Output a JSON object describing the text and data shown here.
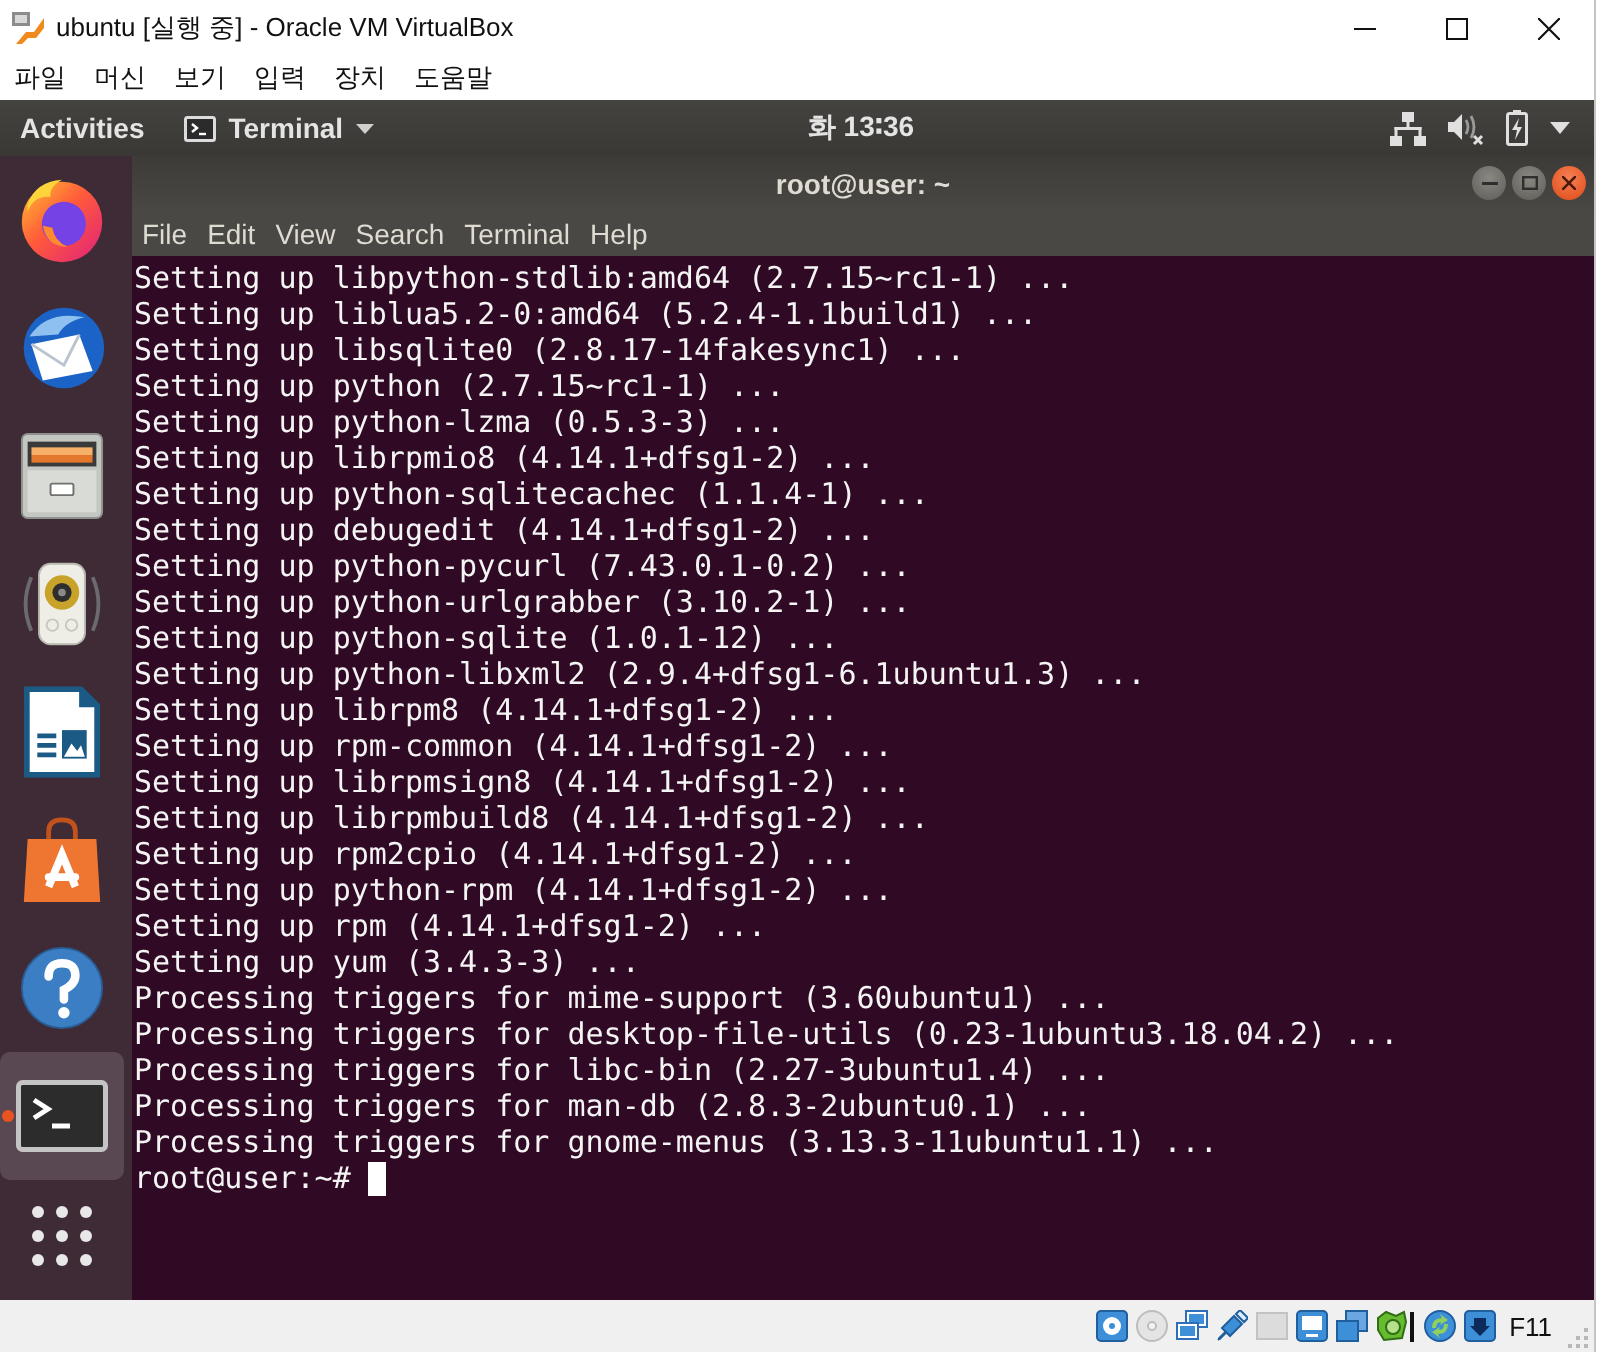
{
  "vbox_window": {
    "title": "ubuntu [실행 중] - Oracle VM VirtualBox"
  },
  "vbox_menu": [
    "파일",
    "머신",
    "보기",
    "입력",
    "장치",
    "도움말"
  ],
  "top_bar": {
    "activities": "Activities",
    "app_menu": "Terminal",
    "clock": "화 13∶36"
  },
  "dock": [
    {
      "kind": "browser",
      "running": false,
      "active": false
    },
    {
      "kind": "mail",
      "running": false,
      "active": false
    },
    {
      "kind": "files",
      "running": false,
      "active": false
    },
    {
      "kind": "music",
      "running": false,
      "active": false
    },
    {
      "kind": "presentation",
      "running": false,
      "active": false
    },
    {
      "kind": "software",
      "running": false,
      "active": false
    },
    {
      "kind": "help",
      "running": false,
      "active": false
    },
    {
      "kind": "terminal",
      "running": true,
      "active": true
    },
    {
      "kind": "apps",
      "running": false,
      "active": false
    }
  ],
  "terminal": {
    "title": "root@user: ~",
    "menu": [
      "File",
      "Edit",
      "View",
      "Search",
      "Terminal",
      "Help"
    ],
    "lines": [
      "Setting up libpython-stdlib:amd64 (2.7.15~rc1-1) ...",
      "Setting up liblua5.2-0:amd64 (5.2.4-1.1build1) ...",
      "Setting up libsqlite0 (2.8.17-14fakesync1) ...",
      "Setting up python (2.7.15~rc1-1) ...",
      "Setting up python-lzma (0.5.3-3) ...",
      "Setting up librpmio8 (4.14.1+dfsg1-2) ...",
      "Setting up python-sqlitecachec (1.1.4-1) ...",
      "Setting up debugedit (4.14.1+dfsg1-2) ...",
      "Setting up python-pycurl (7.43.0.1-0.2) ...",
      "Setting up python-urlgrabber (3.10.2-1) ...",
      "Setting up python-sqlite (1.0.1-12) ...",
      "Setting up python-libxml2 (2.9.4+dfsg1-6.1ubuntu1.3) ...",
      "Setting up librpm8 (4.14.1+dfsg1-2) ...",
      "Setting up rpm-common (4.14.1+dfsg1-2) ...",
      "Setting up librpmsign8 (4.14.1+dfsg1-2) ...",
      "Setting up librpmbuild8 (4.14.1+dfsg1-2) ...",
      "Setting up rpm2cpio (4.14.1+dfsg1-2) ...",
      "Setting up python-rpm (4.14.1+dfsg1-2) ...",
      "Setting up rpm (4.14.1+dfsg1-2) ...",
      "Setting up yum (3.4.3-3) ...",
      "Processing triggers for mime-support (3.60ubuntu1) ...",
      "Processing triggers for desktop-file-utils (0.23-1ubuntu3.18.04.2) ...",
      "Processing triggers for libc-bin (2.27-3ubuntu1.4) ...",
      "Processing triggers for man-db (2.8.3-2ubuntu0.1) ...",
      "Processing triggers for gnome-menus (3.13.3-11ubuntu1.1) ..."
    ],
    "prompt": "root@user:~#"
  },
  "status_bar": {
    "host_key": "F11"
  }
}
